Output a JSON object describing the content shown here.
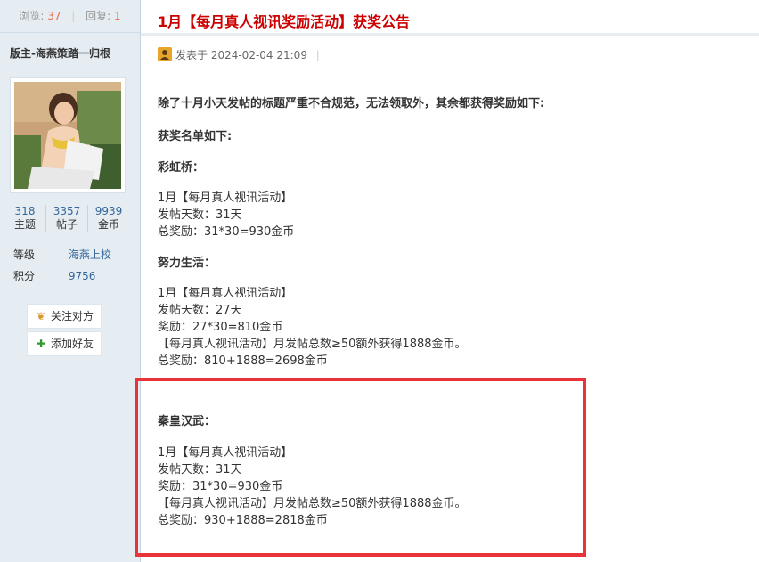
{
  "sidebar": {
    "views_label": "浏览:",
    "views": "37",
    "replies_label": "回复:",
    "replies": "1",
    "author": "版主-海燕策踏一归根",
    "stats": [
      {
        "value": "318",
        "label": "主题"
      },
      {
        "value": "3357",
        "label": "帖子"
      },
      {
        "value": "9939",
        "label": "金币"
      }
    ],
    "level_label": "等级",
    "level_value": "海燕上校",
    "points_label": "积分",
    "points_value": "9756",
    "follow_label": "关注对方",
    "add_friend_label": "添加好友"
  },
  "post": {
    "title": "1月【每月真人视讯奖励活动】获奖公告",
    "posted_at": "发表于 2024-02-04 21:09",
    "intro": "除了十月小天发帖的标题严重不合规范，无法领取外，其余都获得奖励如下:",
    "list_title": "获奖名单如下:",
    "winners": [
      {
        "name": "彩虹桥：",
        "lines": [
          "1月【每月真人视讯活动】",
          " 发帖天数：31天",
          " 总奖励：31*30=930金币"
        ]
      },
      {
        "name": "努力生活：",
        "lines": [
          "1月【每月真人视讯活动】",
          " 发帖天数：27天",
          " 奖励：27*30=810金币",
          "【每月真人视讯活动】月发帖总数≥50额外获得1888金币。",
          " 总奖励：810+1888=2698金币"
        ]
      },
      {
        "name": "秦皇汉武：",
        "lines": [
          "1月【每月真人视讯活动】",
          " 发帖天数：31天",
          " 奖励：31*30=930金币",
          "【每月真人视讯活动】月发帖总数≥50额外获得1888金币。",
          " 总奖励：930+1888=2818金币"
        ]
      }
    ]
  },
  "colors": {
    "title_red": "#cc0000",
    "highlight": "#e8333a",
    "sidebar_bg": "#e5edf2",
    "link_blue": "#336699"
  }
}
